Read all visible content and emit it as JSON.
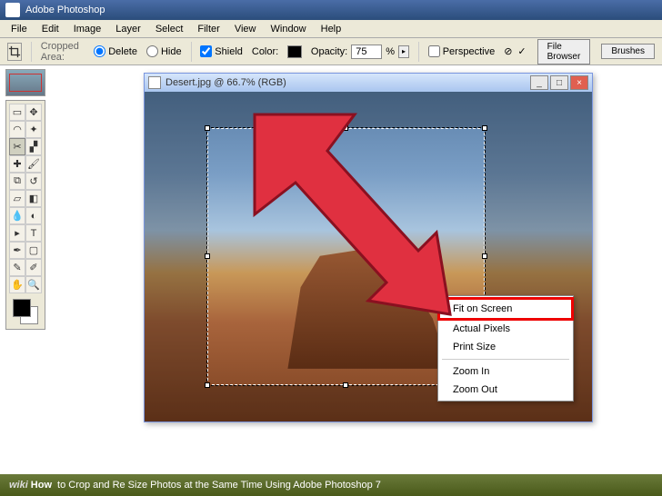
{
  "app_title": "Adobe Photoshop",
  "menus": [
    "File",
    "Edit",
    "Image",
    "Layer",
    "Select",
    "Filter",
    "View",
    "Window",
    "Help"
  ],
  "options": {
    "cropped_area_label": "Cropped Area:",
    "delete_label": "Delete",
    "hide_label": "Hide",
    "shield_label": "Shield",
    "color_label": "Color:",
    "opacity_label": "Opacity:",
    "opacity_value": "75",
    "opacity_pct": "%",
    "perspective_label": "Perspective"
  },
  "tabs": {
    "file_browser": "File Browser",
    "brushes": "Brushes"
  },
  "doc": {
    "title": "Desert.jpg @ 66.7% (RGB)",
    "min": "_",
    "max": "□",
    "close": "×"
  },
  "context_menu": {
    "items": [
      {
        "label": "Fit on Screen",
        "highlighted": true
      },
      {
        "label": "Actual Pixels",
        "highlighted": false
      },
      {
        "label": "Print Size",
        "highlighted": false
      }
    ],
    "items2": [
      {
        "label": "Zoom In"
      },
      {
        "label": "Zoom Out"
      }
    ]
  },
  "caption": {
    "brand1": "wiki",
    "brand2": "How",
    "text": "to Crop and Re Size Photos at the Same Time Using Adobe Photoshop 7"
  }
}
